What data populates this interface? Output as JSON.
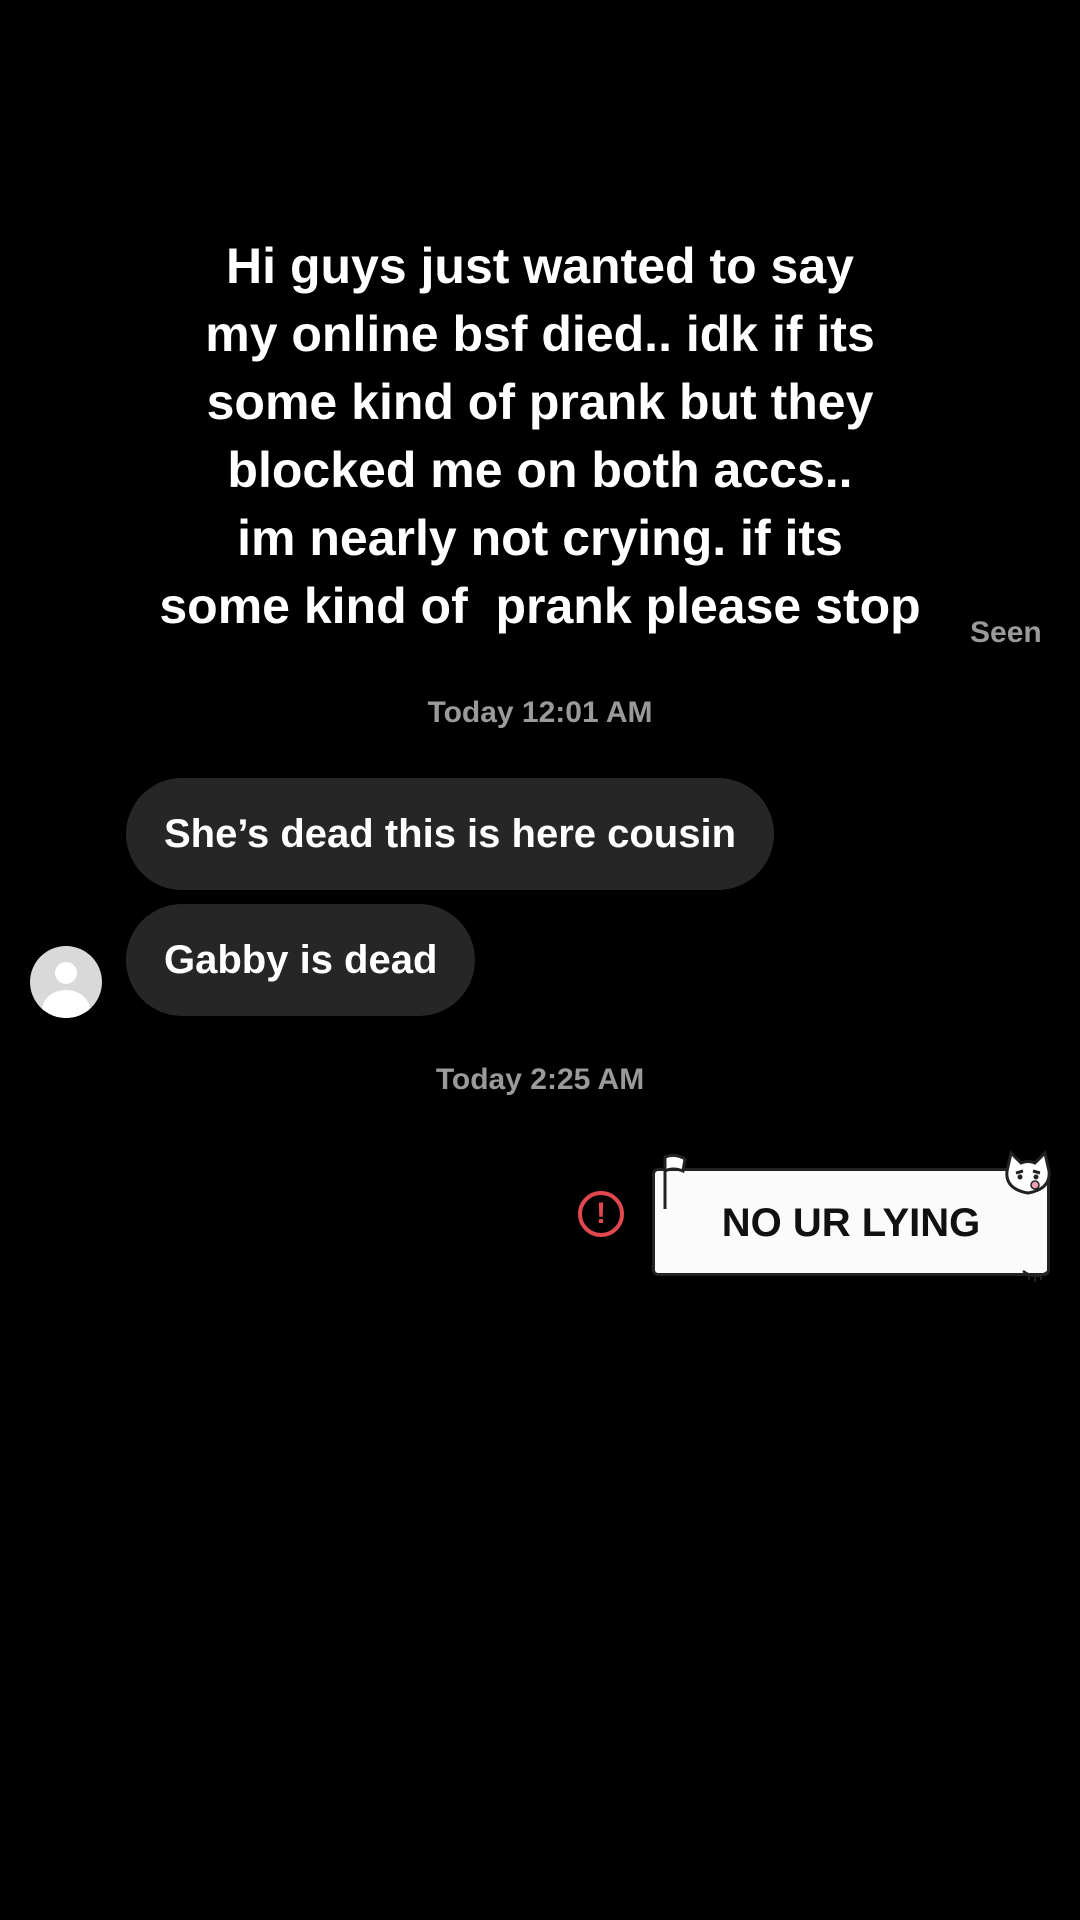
{
  "caption": {
    "lines": [
      "Hi guys just wanted to say",
      "my online bsf died.. idk if its",
      "some kind of prank but they",
      "blocked me on both accs..",
      "im nearly not crying. if its",
      "some kind of  prank please stop"
    ]
  },
  "status": {
    "seen": "Seen"
  },
  "thread": {
    "timestamp_1": "Today 12:01 AM",
    "received": [
      "She’s dead this is here cousin",
      "Gabby is dead"
    ],
    "timestamp_2": "Today 2:25 AM",
    "sent_sticker_text": "NO UR LYING",
    "error_symbol": "!"
  },
  "colors": {
    "background": "#000000",
    "bubble": "#262626",
    "meta_text": "#9a9a9a",
    "error": "#e0474f"
  },
  "icons": {
    "avatar": "default-user-avatar-icon",
    "error": "alert-circle-icon"
  }
}
